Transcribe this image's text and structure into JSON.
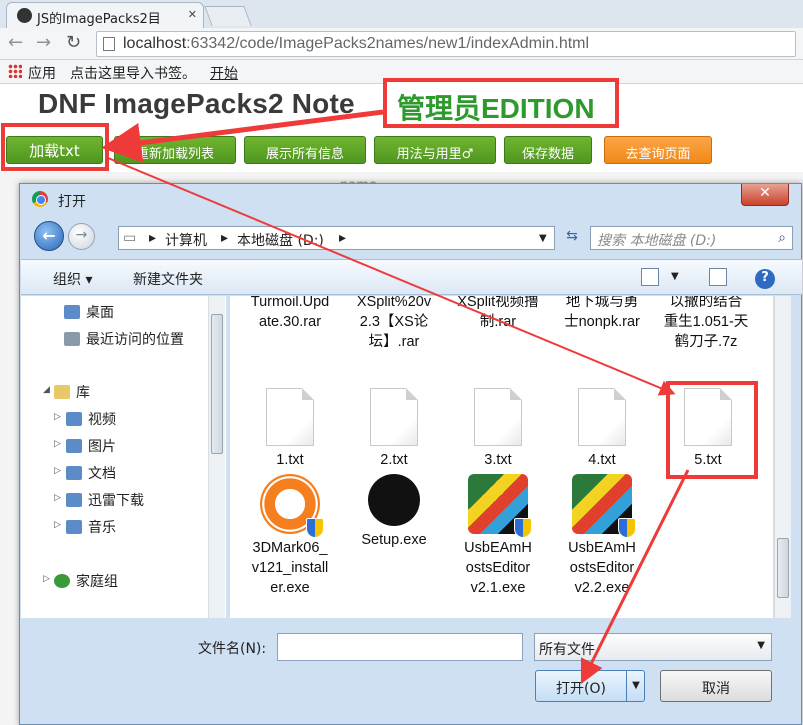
{
  "browser": {
    "tab_title": "JS的ImagePacks2目",
    "url_host": "localhost",
    "url_path": ":63342/code/ImagePacks2names/new1/indexAdmin.html",
    "bookmarks": {
      "apps": "应用",
      "import_hint": "点击这里导入书签。",
      "start": "开始"
    }
  },
  "page": {
    "title": "DNF ImagePacks2 Note",
    "edition": "管理员EDITION",
    "buttons": [
      "加载txt",
      "重新加载列表",
      "展示所有信息",
      "用法与用里♂",
      "保存数据",
      "去查询页面"
    ],
    "table_header": "name"
  },
  "dialog": {
    "title": "打开",
    "close": "✕",
    "breadcrumb": [
      "计算机",
      "本地磁盘 (D:)"
    ],
    "search_placeholder": "搜索 本地磁盘 (D:)",
    "organize": "组织 ▾",
    "new_folder": "新建文件夹",
    "nav": {
      "desktop": "桌面",
      "recent": "最近访问的位置",
      "library": "库",
      "videos": "视频",
      "pictures": "图片",
      "documents": "文档",
      "xunlei": "迅雷下载",
      "music": "音乐",
      "homegroup": "家庭组"
    },
    "files_row1": [
      "Turmoil.Update.30.rar",
      "XSplit%20v2.3【XS论坛】.rar",
      "XSplit视频撸制.rar",
      "地下城与勇士nonpk.rar",
      "以撒的结合重生1.051-天鹤刀子.7z"
    ],
    "files_row2": [
      "1.txt",
      "2.txt",
      "3.txt",
      "4.txt",
      "5.txt"
    ],
    "files_row3": [
      "3DMark06_v121_installer.exe",
      "Setup.exe",
      "UsbEAmHostsEditor v2.1.exe",
      "UsbEAmHostsEditor v2.2.exe"
    ],
    "filename_label": "文件名(N):",
    "filename_value": "",
    "filter": "所有文件",
    "open": "打开(O)",
    "cancel": "取消"
  },
  "colors": {
    "annotation_red": "#ef3a3a",
    "button_green": "#5aa125",
    "button_orange": "#f39522",
    "edition_green": "#2e9a2e"
  }
}
